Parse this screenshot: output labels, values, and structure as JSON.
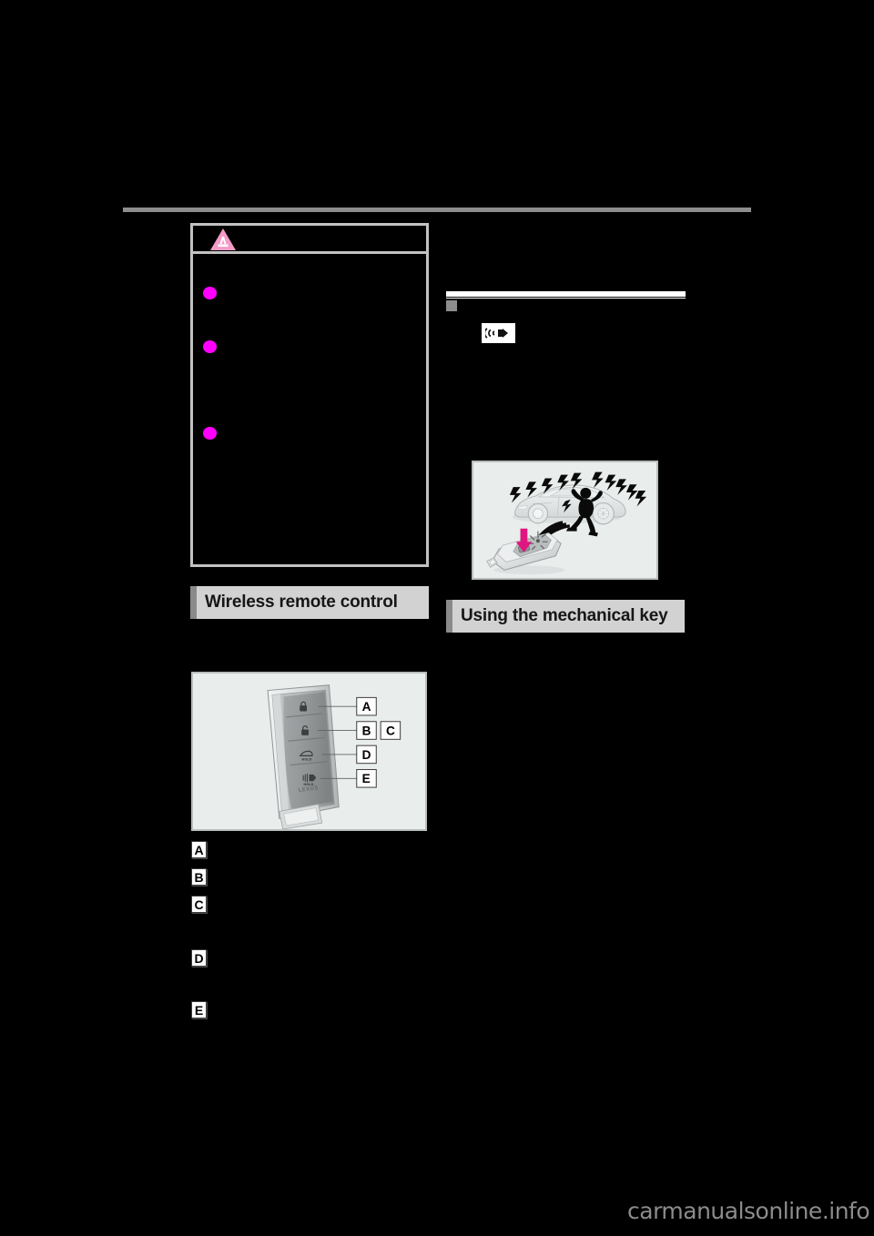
{
  "page": {
    "background_color": "#000000",
    "rule_color": "#8d8d8d",
    "accent_bullet_color": "#ff00ff",
    "warning_icon_color": "#f39ac7",
    "header_bar_color": "#d2d2d2",
    "header_tab_color": "#8a8a8a"
  },
  "warning": {
    "icon_name": "warning-triangle-icon",
    "bullets": [
      "",
      "",
      ""
    ]
  },
  "sections": {
    "wireless_remote_control": {
      "title": "Wireless remote control",
      "callouts": [
        {
          "id": "A",
          "text": ""
        },
        {
          "id": "B",
          "text": ""
        },
        {
          "id": "C",
          "text": ""
        },
        {
          "id": "D",
          "text": ""
        },
        {
          "id": "E",
          "text": ""
        }
      ]
    },
    "using_the_mechanical_key": {
      "title": "Using the mechanical key"
    }
  },
  "subsection": {
    "marker_name": "square-bullet-marker",
    "title": "",
    "buzzer_icon_name": "speaker-buzzer-icon"
  },
  "figures": {
    "alarm": {
      "name": "panic-alarm-illustration",
      "caption": "",
      "elements": {
        "vehicle": "sedan outline",
        "person": "running figure silhouette",
        "remote": "wireless remote control with panic button pressed",
        "arrow_color": "#e0157f",
        "sound_waves": 3,
        "light_flashes": 11
      }
    },
    "key_fob": {
      "name": "wireless-remote-control-illustration",
      "brand": "LEXUS",
      "buttons": [
        {
          "callout": "A",
          "icon": "lock-icon",
          "label": ""
        },
        {
          "callout": "B",
          "icon": "unlock-icon",
          "label": ""
        },
        {
          "callout": "D",
          "icon": "trunk-icon",
          "label": "HOLD"
        },
        {
          "callout": "E",
          "icon": "panic-alarm-icon",
          "label": "HOLD"
        }
      ],
      "callout_labels": [
        "A",
        "B",
        "C",
        "D",
        "E"
      ]
    }
  },
  "watermark": {
    "text": "carmanualsonline.info"
  }
}
